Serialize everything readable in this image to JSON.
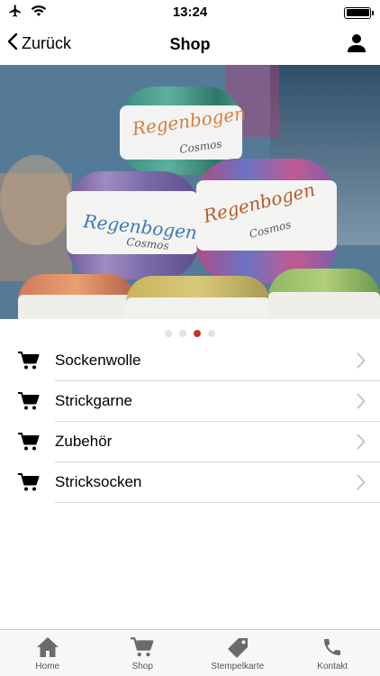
{
  "status_bar": {
    "time": "13:24"
  },
  "nav": {
    "back_label": "Zurück",
    "title": "Shop"
  },
  "hero": {
    "carousel_pages": 4,
    "active_page": 3,
    "yarn_label_brand": "Regenbogen",
    "yarn_label_line": "Cosmos"
  },
  "menu": {
    "items": [
      {
        "label": "Sockenwolle"
      },
      {
        "label": "Strickgarne"
      },
      {
        "label": "Zubehör"
      },
      {
        "label": "Stricksocken"
      }
    ]
  },
  "tabs": {
    "home": "Home",
    "shop": "Shop",
    "stamp": "Stempelkarte",
    "contact": "Kontakt"
  },
  "colors": {
    "page_indicator_active": "#c0392b",
    "page_indicator_inactive": "#e2e2e2",
    "tab_icon": "#6b6b6b"
  }
}
